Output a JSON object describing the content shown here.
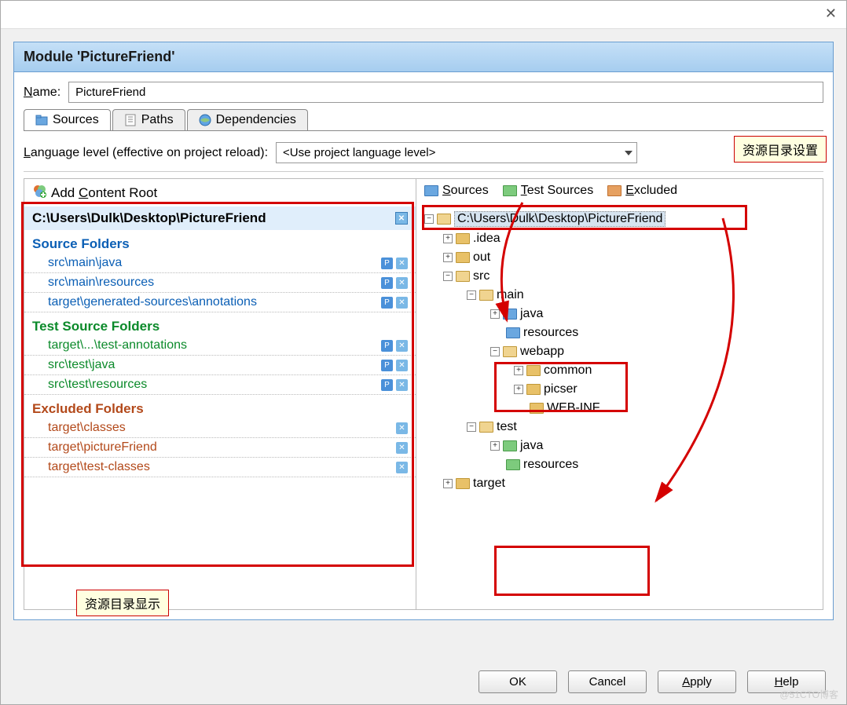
{
  "window": {
    "title": "Module 'PictureFriend'"
  },
  "name": {
    "label_html": "Name:",
    "underline": "N",
    "value": "PictureFriend"
  },
  "tabs": {
    "sources": "Sources",
    "paths": "Paths",
    "deps": "Dependencies"
  },
  "lang": {
    "label": "Language level (effective on project reload):",
    "value": "<Use project language level>"
  },
  "callouts": {
    "settings": "资源目录设置",
    "display": "资源目录显示"
  },
  "left": {
    "add_root": "Add Content Root",
    "root_path": "C:\\Users\\Dulk\\Desktop\\PictureFriend",
    "source_title": "Source Folders",
    "sources": [
      "src\\main\\java",
      "src\\main\\resources",
      "target\\generated-sources\\annotations"
    ],
    "test_title": "Test Source Folders",
    "tests": [
      "target\\...\\test-annotations",
      "src\\test\\java",
      "src\\test\\resources"
    ],
    "excluded_title": "Excluded Folders",
    "excluded": [
      "target\\classes",
      "target\\pictureFriend",
      "target\\test-classes"
    ]
  },
  "markbar": {
    "sources": "Sources",
    "tests": "Test Sources",
    "excluded": "Excluded"
  },
  "tree": {
    "root": "C:\\Users\\Dulk\\Desktop\\PictureFriend",
    "idea": ".idea",
    "out": "out",
    "src": "src",
    "main": "main",
    "java": "java",
    "resources": "resources",
    "webapp": "webapp",
    "common": "common",
    "picser": "picser",
    "webinf": "WEB-INF",
    "test": "test",
    "target": "target"
  },
  "buttons": {
    "ok": "OK",
    "cancel": "Cancel",
    "apply": "Apply",
    "help": "Help"
  },
  "watermark": "@51CTO博客"
}
